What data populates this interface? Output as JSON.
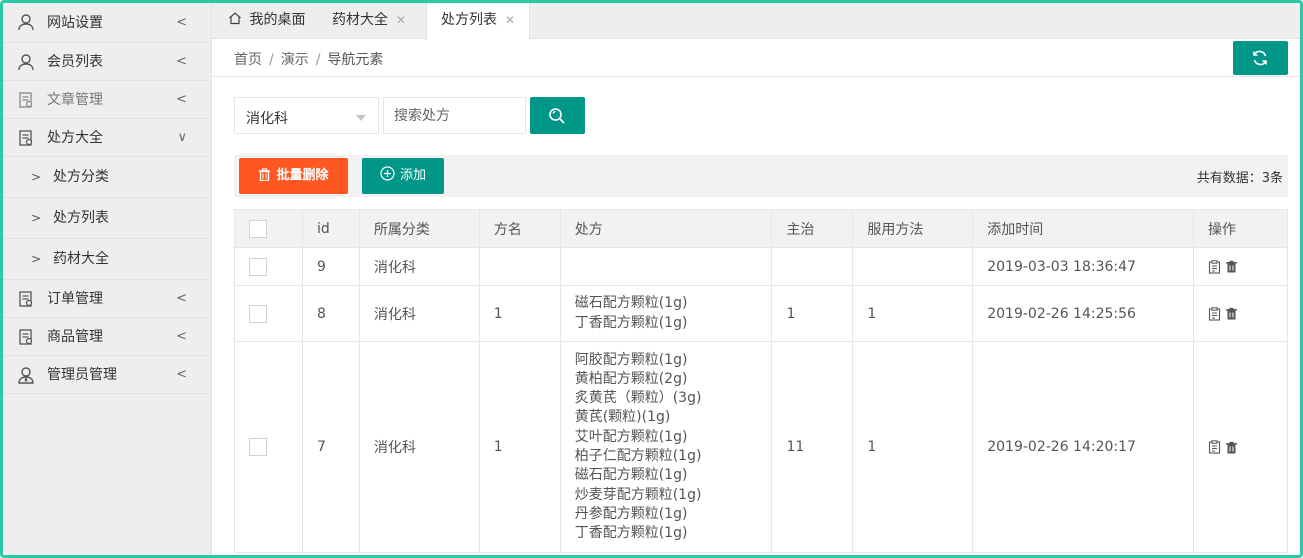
{
  "sidebar": {
    "items": [
      {
        "label": "网站设置",
        "caret": "<"
      },
      {
        "label": "会员列表",
        "caret": "<"
      },
      {
        "label": "文章管理",
        "caret": "<"
      },
      {
        "label": "处方大全",
        "caret": "∨"
      },
      {
        "label": "订单管理",
        "caret": "<"
      },
      {
        "label": "商品管理",
        "caret": "<"
      },
      {
        "label": "管理员管理",
        "caret": "<"
      }
    ],
    "subitems": [
      {
        "label": "处方分类"
      },
      {
        "label": "处方列表"
      },
      {
        "label": "药材大全"
      }
    ]
  },
  "tabs": [
    {
      "label": "我的桌面"
    },
    {
      "label": "药材大全"
    },
    {
      "label": "处方列表"
    }
  ],
  "breadcrumb": [
    "首页",
    "演示",
    "导航元素"
  ],
  "filter": {
    "category": "消化科",
    "search_placeholder": "搜索处方"
  },
  "toolbar": {
    "delete_label": "批量删除",
    "add_label": "添加",
    "total_text": "共有数据：3条"
  },
  "table": {
    "headers": [
      "id",
      "所属分类",
      "方名",
      "处方",
      "主治",
      "服用方法",
      "添加时间",
      "操作"
    ],
    "rows": [
      {
        "id": "9",
        "category": "消化科",
        "name": "",
        "prescription": [],
        "indication": "",
        "usage": "",
        "added": "2019-03-03 18:36:47"
      },
      {
        "id": "8",
        "category": "消化科",
        "name": "1",
        "prescription": [
          "磁石配方颗粒(1g)",
          "丁香配方颗粒(1g)"
        ],
        "indication": "1",
        "usage": "1",
        "added": "2019-02-26 14:25:56"
      },
      {
        "id": "7",
        "category": "消化科",
        "name": "1",
        "prescription": [
          "阿胶配方颗粒(1g)",
          "黄柏配方颗粒(2g)",
          "炙黄芪（颗粒）(3g)",
          "黄芪(颗粒)(1g)",
          "艾叶配方颗粒(1g)",
          "柏子仁配方颗粒(1g)",
          "磁石配方颗粒(1g)",
          "炒麦芽配方颗粒(1g)",
          "丹参配方颗粒(1g)",
          "丁香配方颗粒(1g)"
        ],
        "indication": "11",
        "usage": "1",
        "added": "2019-02-26 14:20:17"
      }
    ]
  },
  "colors": {
    "primary": "#009688",
    "danger": "#ff5722",
    "frame": "#2dc9a6"
  }
}
